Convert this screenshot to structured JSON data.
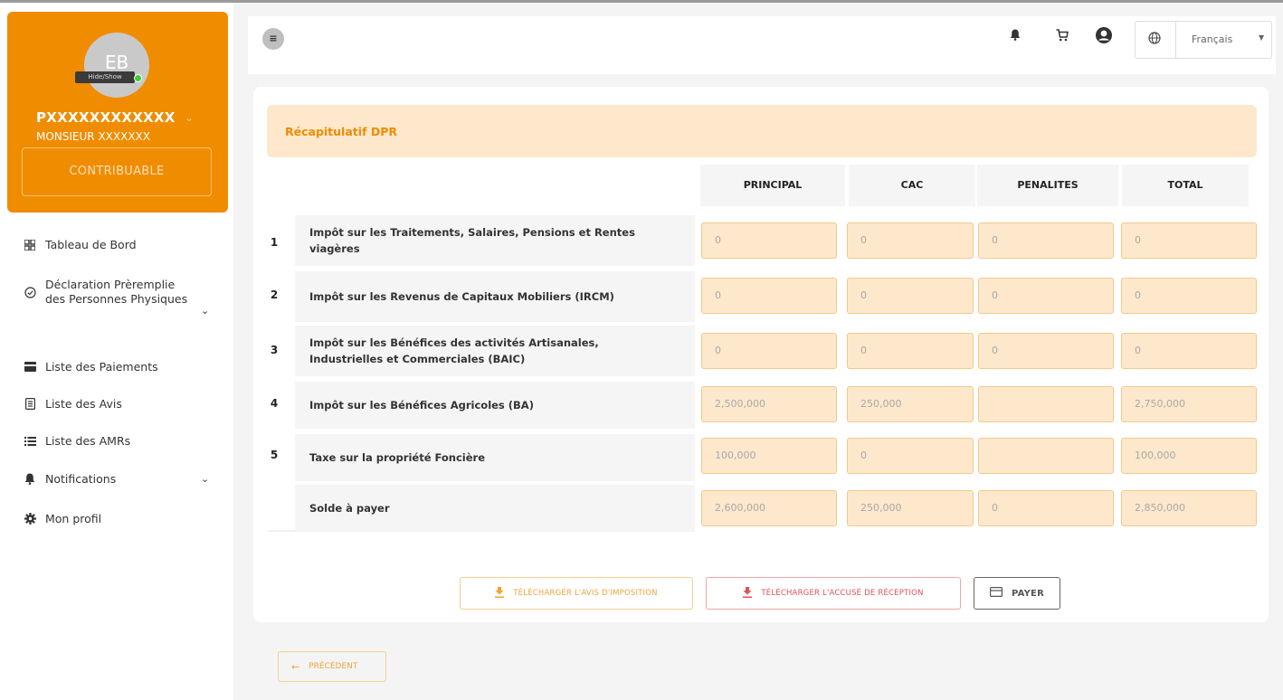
{
  "sidebar": {
    "avatar_initials": "EB",
    "avatar_tooltip": "Hide/Show",
    "user_id": "PXXXXXXXXXXXX",
    "user_name": "MONSIEUR XXXXXXX",
    "role": "CONTRIBUABLE",
    "nav": [
      {
        "label": "Tableau de Bord",
        "icon": "grid-icon"
      },
      {
        "label": "Déclaration Prèremplie des Personnes Physiques",
        "icon": "check-circle-icon"
      },
      {
        "label": "Liste des Paiements",
        "icon": "card-icon"
      },
      {
        "label": "Liste des Avis",
        "icon": "document-icon"
      },
      {
        "label": "Liste des AMRs",
        "icon": "list-icon"
      },
      {
        "label": "Notifications",
        "icon": "bell-icon"
      },
      {
        "label": "Mon profil",
        "icon": "gear-icon"
      }
    ]
  },
  "topbar": {
    "language": "Français",
    "icons": [
      "menu-toggle-icon",
      "bell-icon",
      "cart-icon",
      "user-circle-icon",
      "globe-icon"
    ]
  },
  "summary": {
    "title": "Récapitulatif DPR",
    "columns": [
      "PRINCIPAL",
      "CAC",
      "PENALITES",
      "TOTAL"
    ],
    "rows": [
      {
        "num": "1",
        "label": "Impôt sur les Traitements, Salaires, Pensions et Rentes viagères",
        "values": [
          "0",
          "0",
          "0",
          "0"
        ]
      },
      {
        "num": "2",
        "label": "Impôt sur les Revenus de Capitaux Mobiliers (IRCM)",
        "values": [
          "0",
          "0",
          "0",
          "0"
        ]
      },
      {
        "num": "3",
        "label": "Impôt sur les Bénéfices des activités Artisanales, Industrielles et Commerciales (BAIC)",
        "values": [
          "0",
          "0",
          "0",
          "0"
        ]
      },
      {
        "num": "4",
        "label": "Impôt sur les Bénéfices Agricoles (BA)",
        "values": [
          "2,500,000",
          "250,000",
          "",
          "2,750,000"
        ]
      },
      {
        "num": "5",
        "label": "Taxe sur la propriété Foncière",
        "values": [
          "100,000",
          "0",
          "",
          "100,000"
        ]
      },
      {
        "num": "",
        "label": "Solde à payer",
        "values": [
          "2,600,000",
          "250,000",
          "0",
          "2,850,000"
        ]
      }
    ]
  },
  "actions": {
    "avis": "TÉLÉCHARGER L'AVIS D'IMPOSITION",
    "accuse": "TÉLÉCHARGER L'ACCUSÉ DE RÉCEPTION",
    "payer": "PAYER",
    "previous": "PRÉCÉDENT"
  },
  "colors": {
    "accent": "#f08c00",
    "accent_light": "#fde8cc",
    "danger": "#e0505b"
  }
}
